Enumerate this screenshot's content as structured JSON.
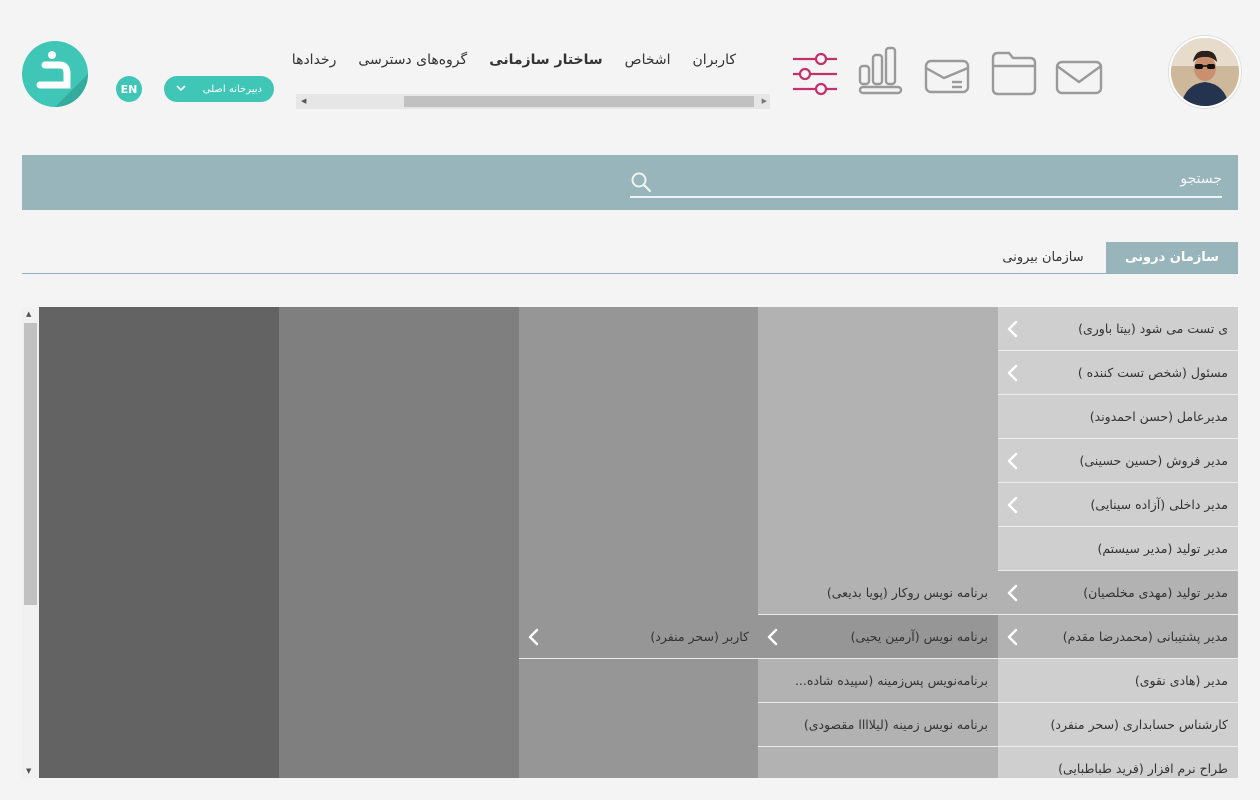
{
  "header": {
    "logo_glyph": "ذ",
    "language": "EN",
    "office_select": "دبیرخانه اصلی",
    "nav": [
      "کاربران",
      "اشخاص",
      "ساختار سازمانی",
      "گروه‌های دسترسی",
      "رخدادها"
    ],
    "nav_active": "ساختار سازمانی",
    "icons": [
      "settings-sliders-icon",
      "chart-icon",
      "inbox-card-icon",
      "folder-icon",
      "mail-icon"
    ],
    "accent_color": "#c2306e",
    "brand_color": "#3fc6b7"
  },
  "search": {
    "placeholder": "جستجو"
  },
  "tabs": {
    "internal": "سازمان درونی",
    "external": "سازمان بیرونی"
  },
  "columns": [
    {
      "rows": [
        {
          "label": "ی تست می شود (بیتا باوری)",
          "chevron": true
        },
        {
          "label": "مسئول (شخص تست کننده )",
          "chevron": true
        },
        {
          "label": "مدیرعامل (حسن احمدوند)",
          "chevron": false
        },
        {
          "label": "مدیر فروش (حسین حسینی)",
          "chevron": true
        },
        {
          "label": "مدیر داخلی (آزاده سینایی)",
          "chevron": true
        },
        {
          "label": "مدیر تولید (مدیر سیستم)",
          "chevron": false
        },
        {
          "label": "مدیر تولید (مهدی مخلصیان)",
          "chevron": true
        },
        {
          "label": "مدیر پشتیبانی (محمدرضا مقدم)",
          "chevron": true
        },
        {
          "label": "مدیر (هادی نقوی)",
          "chevron": false
        },
        {
          "label": "کارشناس حسابداری (سحر منفرد)",
          "chevron": false
        },
        {
          "label": "طراح نرم افزار (فرید طباطبایی)",
          "chevron": false
        }
      ]
    },
    {
      "rows": [
        {
          "label": "برنامه نویس روکار (پویا بدیعی)",
          "chevron": false
        },
        {
          "label": "برنامه نویس (آرمین یحیی)",
          "chevron": true
        },
        {
          "label": "برنامه‌نویس پس‌زمینه (سپیده شاده...",
          "chevron": false
        },
        {
          "label": "برنامه نویس زمینه (لیلاااا مقصودی)",
          "chevron": false
        }
      ]
    },
    {
      "rows": [
        {
          "label": "کاربر (سحر منفرد)",
          "chevron": true
        }
      ]
    }
  ]
}
